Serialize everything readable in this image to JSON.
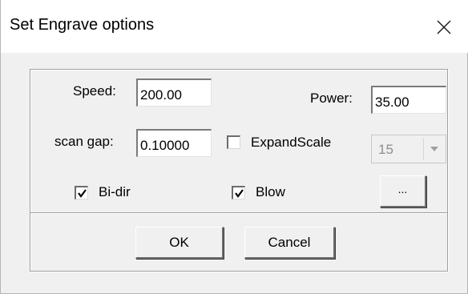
{
  "dialog": {
    "title": "Set Engrave options"
  },
  "fields": {
    "speed_label": "Speed:",
    "speed_value": "200.00",
    "power_label": "Power:",
    "power_value": "35.00",
    "scan_gap_label": "scan gap:",
    "scan_gap_value": "0.10000"
  },
  "options": {
    "expand_scale_label": "ExpandScale",
    "expand_scale_checked": false,
    "expand_scale_value": "15",
    "bidir_label": "Bi-dir",
    "bidir_checked": true,
    "blow_label": "Blow",
    "blow_checked": true,
    "more_button_label": "..."
  },
  "actions": {
    "ok_label": "OK",
    "cancel_label": "Cancel"
  },
  "icons": {
    "close": "close-icon",
    "checkmark": "checkmark-icon",
    "dropdown": "chevron-down-icon"
  }
}
